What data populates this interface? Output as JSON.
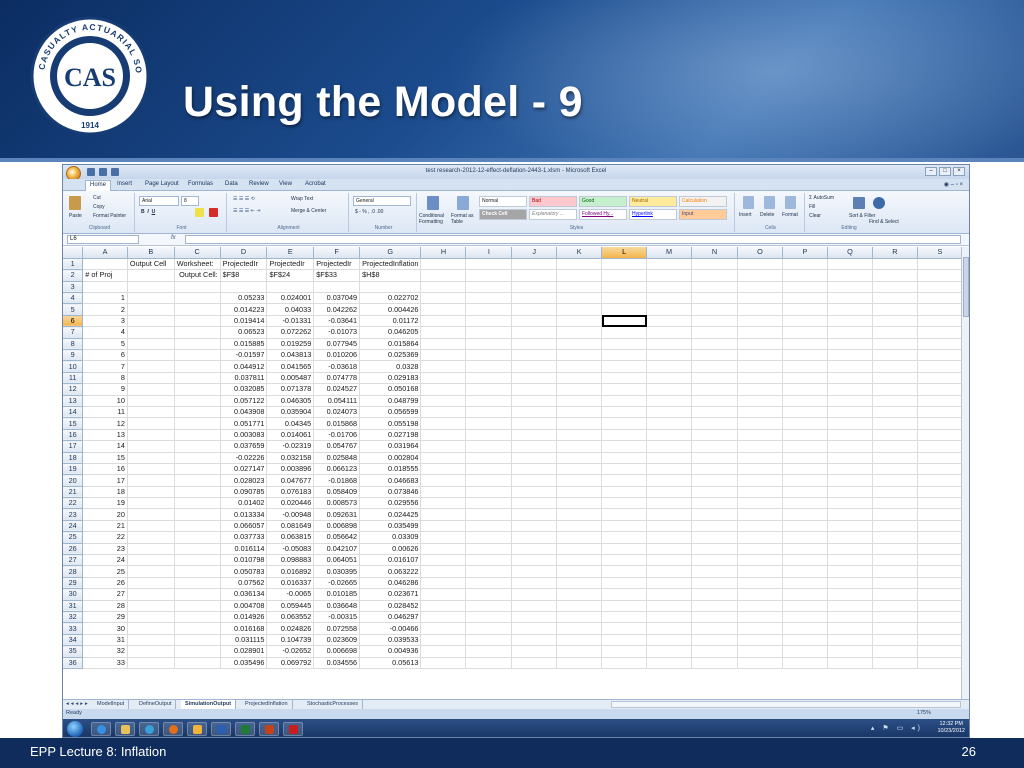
{
  "slide": {
    "title": "Using the Model - 9",
    "footer_label": "EPP Lecture 8:  Inflation",
    "page_number": "26",
    "logo_text": "CAS CASUALTY ACTUARIAL SOCIETY 1914"
  },
  "excel": {
    "window_title": "test research-2012-12-effect-deflation-2443-1.xlsm - Microsoft Excel",
    "ribbon_tabs": [
      "Home",
      "Insert",
      "Page Layout",
      "Formulas",
      "Data",
      "Review",
      "View",
      "Acrobat"
    ],
    "ribbon": {
      "clipboard": {
        "paste": "Paste",
        "cut": "Cut",
        "copy": "Copy",
        "format_painter": "Format Painter",
        "label": "Clipboard"
      },
      "font": {
        "name": "Arial",
        "size": "8",
        "label": "Font"
      },
      "alignment": {
        "wrap": "Wrap Text",
        "merge": "Merge & Center",
        "label": "Alignment"
      },
      "number": {
        "format": "General",
        "label": "Number"
      },
      "styles": {
        "conditional": "Conditional Formatting",
        "format_table": "Format as Table",
        "normal": "Normal",
        "bad": "Bad",
        "good": "Good",
        "neutral": "Neutral",
        "calculation": "Calculation",
        "check_cell": "Check Cell",
        "explanatory": "Explanatory ...",
        "followed_hyperlink": "Followed Hy...",
        "hyperlink": "Hyperlink",
        "input": "Input",
        "label": "Styles"
      },
      "cells": {
        "insert": "Insert",
        "delete": "Delete",
        "format": "Format",
        "label": "Cells"
      },
      "editing": {
        "autosum": "AutoSum",
        "fill": "Fill",
        "clear": "Clear",
        "sort": "Sort & Filter",
        "find": "Find & Select",
        "label": "Editing"
      }
    },
    "name_box": "L6",
    "fx": "fx",
    "columns": [
      "A",
      "B",
      "C",
      "D",
      "E",
      "F",
      "G",
      "H",
      "I",
      "J",
      "K",
      "L",
      "M",
      "N",
      "O",
      "P",
      "Q",
      "R",
      "S"
    ],
    "selected_cell": {
      "row": 6,
      "col": "L"
    },
    "rows": [
      [
        "",
        "Output Cell",
        "Worksheet:",
        "ProjectedIr",
        "ProjectedIr",
        "ProjectedIr",
        "ProjectedInflation"
      ],
      [
        "# of Proj",
        "",
        "Output Cell:",
        "$F$8",
        "$F$24",
        "$F$33",
        "$H$8"
      ],
      [
        "",
        "",
        "",
        "",
        "",
        "",
        ""
      ],
      [
        "1",
        "",
        "",
        "0.05233",
        "0.024001",
        "0.037049",
        "0.022702"
      ],
      [
        "2",
        "",
        "",
        "0.014223",
        "0.04033",
        "0.042262",
        "0.004426"
      ],
      [
        "3",
        "",
        "",
        "0.019414",
        "-0.01331",
        "-0.03641",
        "0.01172"
      ],
      [
        "4",
        "",
        "",
        "0.06523",
        "0.072262",
        "-0.01073",
        "0.046205"
      ],
      [
        "5",
        "",
        "",
        "0.015885",
        "0.019259",
        "0.077945",
        "0.015864"
      ],
      [
        "6",
        "",
        "",
        "-0.01597",
        "0.043813",
        "0.010206",
        "0.025369"
      ],
      [
        "7",
        "",
        "",
        "0.044912",
        "0.041565",
        "-0.03618",
        "0.0328"
      ],
      [
        "8",
        "",
        "",
        "0.037811",
        "0.005487",
        "0.074778",
        "0.029183"
      ],
      [
        "9",
        "",
        "",
        "0.032085",
        "0.071378",
        "0.024527",
        "0.050168"
      ],
      [
        "10",
        "",
        "",
        "0.057122",
        "0.046305",
        "0.054111",
        "0.048799"
      ],
      [
        "11",
        "",
        "",
        "0.043908",
        "0.035904",
        "0.024073",
        "0.056599"
      ],
      [
        "12",
        "",
        "",
        "0.051771",
        "0.04345",
        "0.015868",
        "0.055198"
      ],
      [
        "13",
        "",
        "",
        "0.003083",
        "0.014061",
        "-0.01706",
        "0.027198"
      ],
      [
        "14",
        "",
        "",
        "0.037659",
        "-0.02319",
        "0.054767",
        "0.031964"
      ],
      [
        "15",
        "",
        "",
        "-0.02226",
        "0.032158",
        "0.025848",
        "0.002804"
      ],
      [
        "16",
        "",
        "",
        "0.027147",
        "0.003896",
        "0.066123",
        "0.018555"
      ],
      [
        "17",
        "",
        "",
        "0.028023",
        "0.047677",
        "-0.01868",
        "0.046683"
      ],
      [
        "18",
        "",
        "",
        "0.090785",
        "0.076183",
        "0.058409",
        "0.073846"
      ],
      [
        "19",
        "",
        "",
        "0.01402",
        "0.020446",
        "0.008573",
        "0.029556"
      ],
      [
        "20",
        "",
        "",
        "0.013334",
        "-0.00948",
        "0.092631",
        "0.024425"
      ],
      [
        "21",
        "",
        "",
        "0.066057",
        "0.081649",
        "0.006898",
        "0.035499"
      ],
      [
        "22",
        "",
        "",
        "0.037733",
        "0.063815",
        "0.056642",
        "0.03309"
      ],
      [
        "23",
        "",
        "",
        "0.016114",
        "-0.05083",
        "0.042107",
        "0.00626"
      ],
      [
        "24",
        "",
        "",
        "0.010798",
        "0.098883",
        "0.064051",
        "0.016107"
      ],
      [
        "25",
        "",
        "",
        "0.050783",
        "0.016892",
        "0.030395",
        "0.063222"
      ],
      [
        "26",
        "",
        "",
        "0.07562",
        "0.016337",
        "-0.02665",
        "0.046286"
      ],
      [
        "27",
        "",
        "",
        "0.036134",
        "-0.0065",
        "0.010185",
        "0.023671"
      ],
      [
        "28",
        "",
        "",
        "0.004708",
        "0.059445",
        "0.036648",
        "0.028452"
      ],
      [
        "29",
        "",
        "",
        "0.014926",
        "0.063552",
        "-0.00315",
        "0.046297"
      ],
      [
        "30",
        "",
        "",
        "0.016168",
        "0.024826",
        "0.072558",
        "-0.00466"
      ],
      [
        "31",
        "",
        "",
        "0.031115",
        "0.104739",
        "0.023609",
        "0.039533"
      ],
      [
        "32",
        "",
        "",
        "0.028901",
        "-0.02652",
        "0.006698",
        "0.004936"
      ],
      [
        "33",
        "",
        "",
        "0.035496",
        "0.069792",
        "0.034556",
        "0.05613"
      ]
    ],
    "sheet_tabs": [
      "ModelInput",
      "DefineOutput",
      "SimulationOutput",
      "ProjectedInflation",
      "StochasticProcesses"
    ],
    "active_sheet": "SimulationOutput",
    "status": "Ready",
    "zoom": "175%",
    "clock_time": "12:32 PM",
    "clock_date": "10/23/2012"
  }
}
